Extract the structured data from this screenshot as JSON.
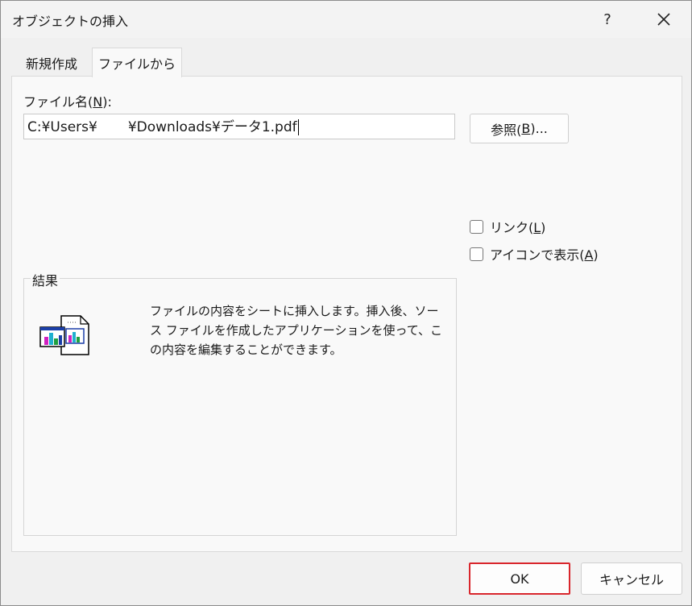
{
  "dialog": {
    "title": "オブジェクトの挿入",
    "help_label": "?"
  },
  "tabs": [
    {
      "label": "新規作成",
      "active": false
    },
    {
      "label": "ファイルから",
      "active": true
    }
  ],
  "file": {
    "label_prefix": "ファイル名(",
    "label_key": "N",
    "label_suffix": "):",
    "path_prefix": "C:¥Users¥",
    "path_suffix": "¥Downloads¥データ1.pdf",
    "browse_prefix": "参照(",
    "browse_key": "B",
    "browse_suffix": ")..."
  },
  "options": {
    "link_prefix": "リンク(",
    "link_key": "L",
    "link_suffix": ")",
    "link_checked": false,
    "icon_prefix": "アイコンで表示(",
    "icon_key": "A",
    "icon_suffix": ")",
    "icon_checked": false
  },
  "result": {
    "legend": "結果",
    "text": "ファイルの内容をシートに挿入します。挿入後、ソース ファイルを作成したアプリケーションを使って、この内容を編集することができます。"
  },
  "buttons": {
    "ok": "OK",
    "cancel": "キャンセル"
  },
  "colors": {
    "highlight": "#d9262c",
    "accent": "#0067c0"
  },
  "icons": {
    "close": "close-icon",
    "object_file": "object-file-icon"
  }
}
